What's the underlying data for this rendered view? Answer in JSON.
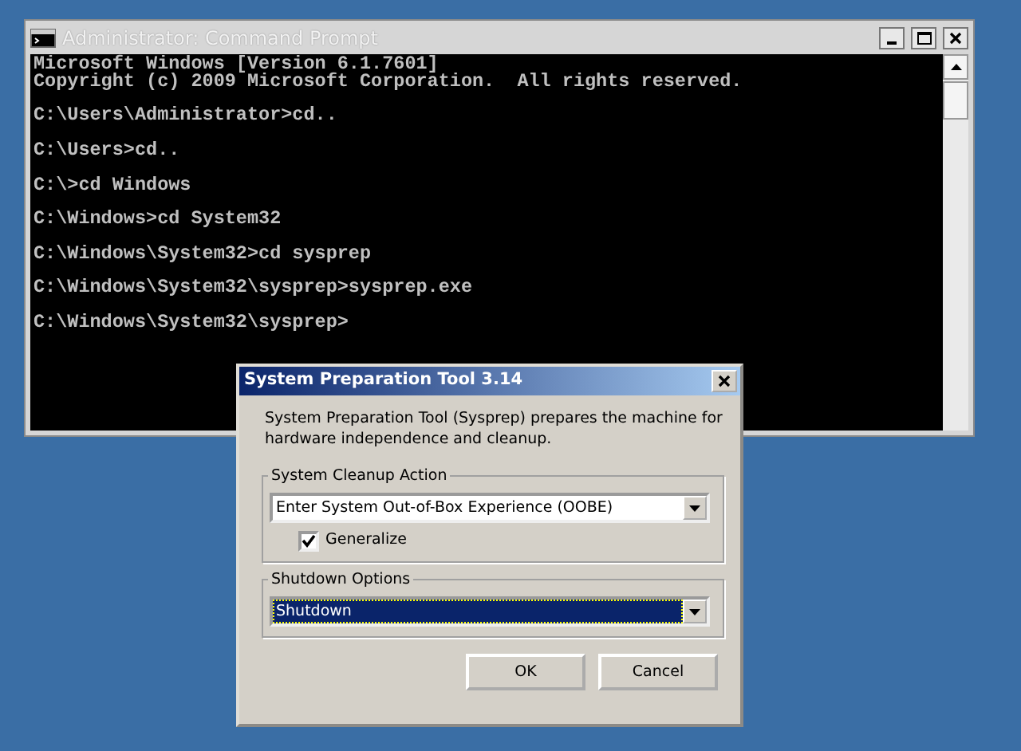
{
  "console_window": {
    "title": "Administrator: Command Prompt",
    "lines": [
      {
        "kind": "banner",
        "text": "Microsoft Windows [Version 6.1.7601]"
      },
      {
        "kind": "banner",
        "text": "Copyright (c) 2009 Microsoft Corporation.  All rights reserved."
      },
      {
        "kind": "command",
        "text": "C:\\Users\\Administrator>cd.."
      },
      {
        "kind": "command",
        "text": "C:\\Users>cd.."
      },
      {
        "kind": "command",
        "text": "C:\\>cd Windows"
      },
      {
        "kind": "command",
        "text": "C:\\Windows>cd System32"
      },
      {
        "kind": "command",
        "text": "C:\\Windows\\System32>cd sysprep"
      },
      {
        "kind": "command",
        "text": "C:\\Windows\\System32\\sysprep>sysprep.exe"
      },
      {
        "kind": "command",
        "text": "C:\\Windows\\System32\\sysprep>"
      }
    ]
  },
  "dialog": {
    "title": "System Preparation Tool 3.14",
    "description": "System Preparation Tool (Sysprep) prepares the machine for hardware independence and cleanup.",
    "groups": [
      {
        "label": "System Cleanup Action",
        "select": {
          "value": "Enter System Out-of-Box Experience (OOBE)",
          "focused": false
        },
        "checkbox": {
          "label": "Generalize",
          "checked": true
        }
      },
      {
        "label": "Shutdown Options",
        "select": {
          "value": "Shutdown",
          "focused": true
        }
      }
    ],
    "buttons": [
      {
        "label": "OK"
      },
      {
        "label": "Cancel"
      }
    ]
  }
}
